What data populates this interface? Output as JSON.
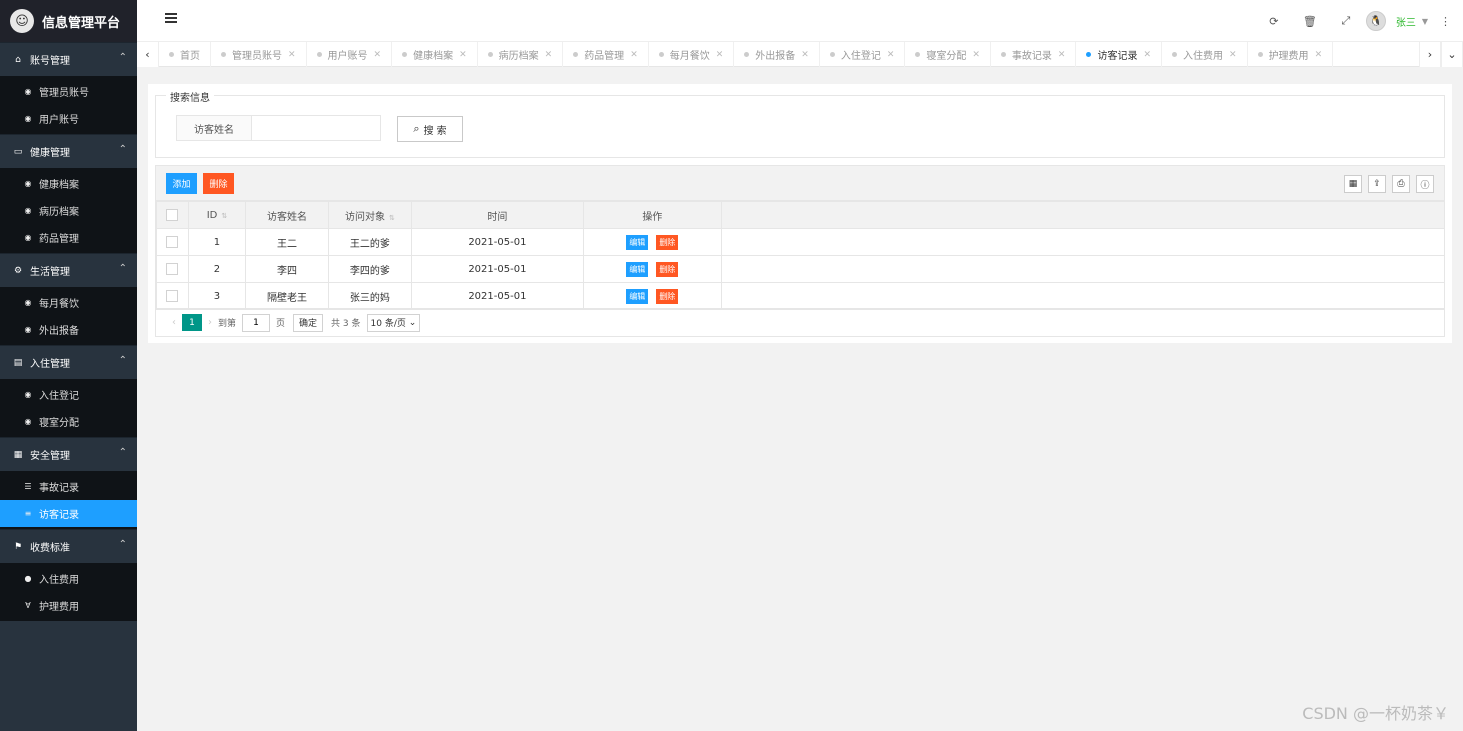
{
  "app": {
    "title": "信息管理平台"
  },
  "sidebar": {
    "groups": [
      {
        "label": "账号管理",
        "icon": "home-icon",
        "items": [
          {
            "label": "管理员账号",
            "icon": "dashboard-icon"
          },
          {
            "label": "用户账号",
            "icon": "dashboard-icon"
          }
        ]
      },
      {
        "label": "健康管理",
        "icon": "window-icon",
        "items": [
          {
            "label": "健康档案",
            "icon": "dashboard-icon"
          },
          {
            "label": "病历档案",
            "icon": "dashboard-icon"
          },
          {
            "label": "药品管理",
            "icon": "dashboard-icon"
          }
        ]
      },
      {
        "label": "生活管理",
        "icon": "gears-icon",
        "items": [
          {
            "label": "每月餐饮",
            "icon": "dashboard-icon"
          },
          {
            "label": "外出报备",
            "icon": "dashboard-icon"
          }
        ]
      },
      {
        "label": "入住管理",
        "icon": "file-icon",
        "items": [
          {
            "label": "入住登记",
            "icon": "dashboard-icon"
          },
          {
            "label": "寝室分配",
            "icon": "dashboard-icon"
          }
        ]
      },
      {
        "label": "安全管理",
        "icon": "calendar-icon",
        "items": [
          {
            "label": "事故记录",
            "icon": "list-icon"
          },
          {
            "label": "访客记录",
            "icon": "bars-icon",
            "active": true
          }
        ]
      },
      {
        "label": "收费标准",
        "icon": "flag-icon",
        "items": [
          {
            "label": "入住费用",
            "icon": "circle-icon"
          },
          {
            "label": "护理费用",
            "icon": "vaadin-icon"
          }
        ]
      }
    ]
  },
  "header": {
    "user_name": "张三",
    "icons": [
      "refresh-icon",
      "trash-icon",
      "fullscreen-icon"
    ]
  },
  "tabs": [
    {
      "label": "首页",
      "closable": false
    },
    {
      "label": "管理员账号",
      "closable": true
    },
    {
      "label": "用户账号",
      "closable": true
    },
    {
      "label": "健康档案",
      "closable": true
    },
    {
      "label": "病历档案",
      "closable": true
    },
    {
      "label": "药品管理",
      "closable": true
    },
    {
      "label": "每月餐饮",
      "closable": true
    },
    {
      "label": "外出报备",
      "closable": true
    },
    {
      "label": "入住登记",
      "closable": true
    },
    {
      "label": "寝室分配",
      "closable": true
    },
    {
      "label": "事故记录",
      "closable": true
    },
    {
      "label": "访客记录",
      "closable": true,
      "active": true
    },
    {
      "label": "入住费用",
      "closable": true
    },
    {
      "label": "护理费用",
      "closable": true
    }
  ],
  "search": {
    "legend": "搜索信息",
    "label": "访客姓名",
    "value": "",
    "button_label": "搜 索"
  },
  "toolbar": {
    "add_label": "添加",
    "delete_label": "删除"
  },
  "table": {
    "headers": [
      "ID",
      "访客姓名",
      "访问对象",
      "时间",
      "操作"
    ],
    "edit_label": "编辑",
    "delete_label": "删除",
    "rows": [
      {
        "id": "1",
        "name": "王二",
        "target": "王二的爹",
        "time": "2021-05-01"
      },
      {
        "id": "2",
        "name": "李四",
        "target": "李四的爹",
        "time": "2021-05-01"
      },
      {
        "id": "3",
        "name": "隔壁老王",
        "target": "张三的妈",
        "time": "2021-05-01"
      }
    ]
  },
  "pager": {
    "current": "1",
    "goto_label": "到第",
    "goto_value": "1",
    "page_label": "页",
    "ok_label": "确定",
    "total_label": "共 3 条",
    "size_label": "10 条/页"
  },
  "watermark": "CSDN @一杯奶茶￥"
}
